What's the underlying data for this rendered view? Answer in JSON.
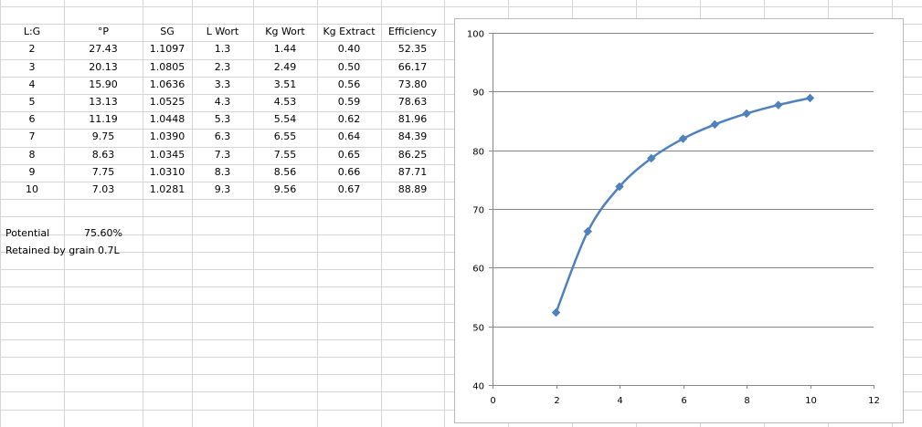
{
  "table": {
    "headers": [
      "L:G",
      "°P",
      "SG",
      "L Wort",
      "Kg Wort",
      "Kg Extract",
      "Efficiency"
    ],
    "rows": [
      [
        "2",
        "27.43",
        "1.1097",
        "1.3",
        "1.44",
        "0.40",
        "52.35"
      ],
      [
        "3",
        "20.13",
        "1.0805",
        "2.3",
        "2.49",
        "0.50",
        "66.17"
      ],
      [
        "4",
        "15.90",
        "1.0636",
        "3.3",
        "3.51",
        "0.56",
        "73.80"
      ],
      [
        "5",
        "13.13",
        "1.0525",
        "4.3",
        "4.53",
        "0.59",
        "78.63"
      ],
      [
        "6",
        "11.19",
        "1.0448",
        "5.3",
        "5.54",
        "0.62",
        "81.96"
      ],
      [
        "7",
        "9.75",
        "1.0390",
        "6.3",
        "6.55",
        "0.64",
        "84.39"
      ],
      [
        "8",
        "8.63",
        "1.0345",
        "7.3",
        "7.55",
        "0.65",
        "86.25"
      ],
      [
        "9",
        "7.75",
        "1.0310",
        "8.3",
        "8.56",
        "0.66",
        "87.71"
      ],
      [
        "10",
        "7.03",
        "1.0281",
        "9.3",
        "9.56",
        "0.67",
        "88.89"
      ]
    ]
  },
  "notes": {
    "potential_label": "Potential",
    "potential_value": "75.60%",
    "retained": "Retained by grain 0.7L"
  },
  "colors": {
    "series": "#4f81bd",
    "gridline": "#868686",
    "sheet_grid": "#d4d4d4"
  },
  "chart_data": {
    "type": "scatter",
    "series": [
      {
        "x": [
          2,
          3,
          4,
          5,
          6,
          7,
          8,
          9,
          10
        ],
        "y": [
          52.35,
          66.17,
          73.8,
          78.63,
          81.96,
          84.39,
          86.25,
          87.71,
          88.89
        ]
      }
    ],
    "line": "smooth",
    "marker": "diamond",
    "xlim": [
      0,
      12
    ],
    "ylim": [
      40,
      100
    ],
    "xticks": [
      0,
      2,
      4,
      6,
      8,
      10,
      12
    ],
    "yticks": [
      40,
      50,
      60,
      70,
      80,
      90,
      100
    ],
    "title": "",
    "xlabel": "",
    "ylabel": "",
    "grid": "horizontal",
    "legend": "none"
  }
}
